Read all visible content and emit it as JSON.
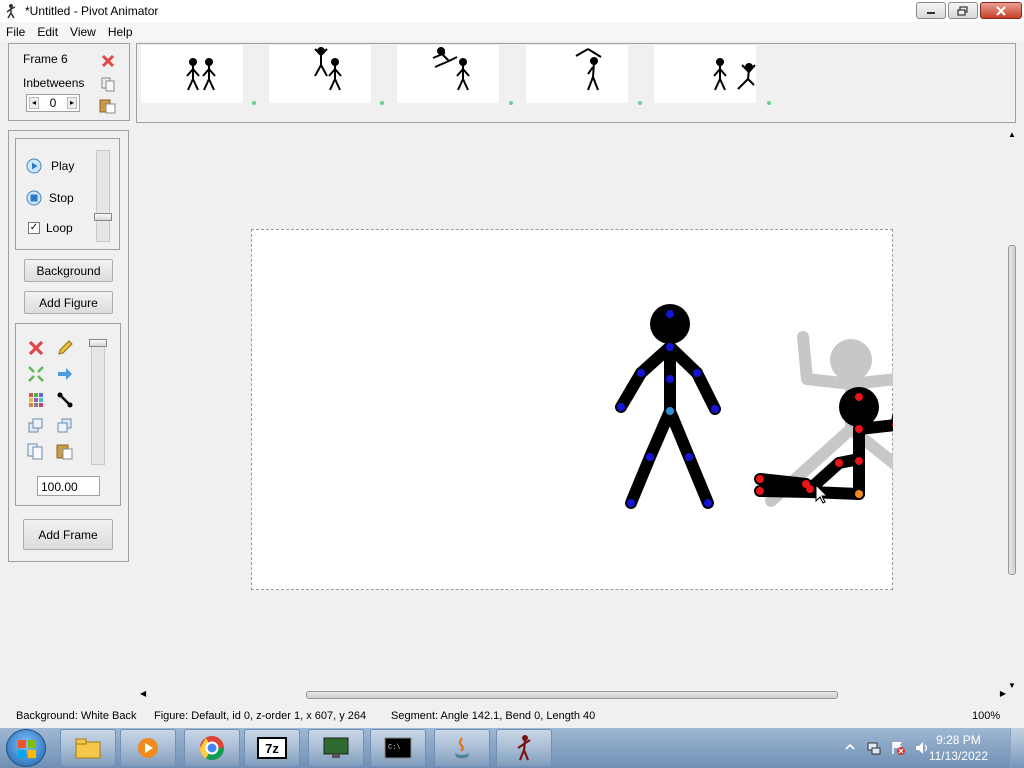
{
  "window": {
    "title": "*Untitled - Pivot Animator"
  },
  "menu": [
    "File",
    "Edit",
    "View",
    "Help"
  ],
  "frame_panel": {
    "frame_label": "Frame 6",
    "inbetweens_label": "Inbetweens",
    "inbetweens_value": "0"
  },
  "playback": {
    "play_label": "Play",
    "stop_label": "Stop",
    "loop_label": "Loop",
    "loop_checked": true
  },
  "buttons": {
    "background": "Background",
    "add_figure": "Add Figure",
    "add_frame": "Add Frame"
  },
  "figure_tools": {
    "scale_value": "100.00"
  },
  "status": {
    "background": "Background: White Back",
    "figure": "Figure: Default,  id 0,  z-order 1,  x 607, y 264",
    "segment": "Segment: Angle 142.1,  Bend 0,  Length 40",
    "zoom": "100%"
  },
  "clock": {
    "time": "9:28 PM",
    "date": "11/13/2022"
  },
  "taskbar_icons": [
    "windows-explorer-icon",
    "media-player-icon",
    "chrome-icon",
    "7zip-icon",
    "remote-desktop-icon",
    "command-prompt-icon",
    "java-icon",
    "pivot-animator-icon"
  ],
  "colors": {
    "selected_joint": "#e8151b",
    "figure_joint": "#1414d8",
    "onion_skin": "#c7c7c7",
    "origin_joint": "#f08a18"
  }
}
